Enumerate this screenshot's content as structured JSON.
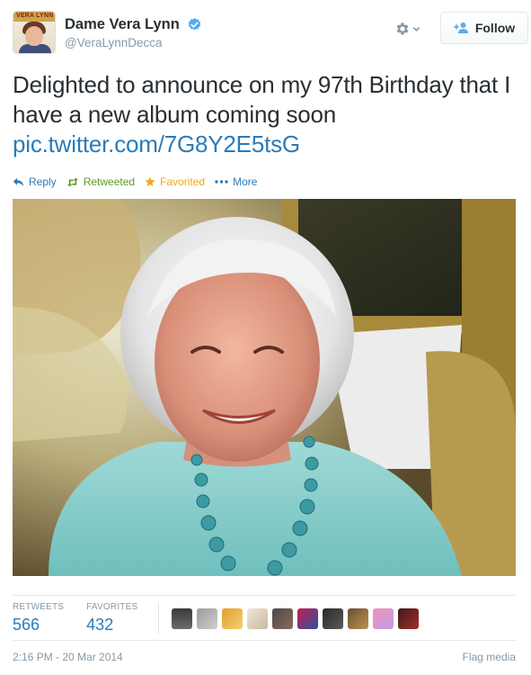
{
  "tweet": {
    "author": {
      "display_name": "Dame Vera Lynn",
      "handle": "@VeraLynnDecca",
      "avatar_text": "VERA LYNN",
      "verified": true
    },
    "follow_label": "Follow",
    "text": "Delighted to announce on my 97th Birthday that I have a new album coming soon",
    "link": "pic.twitter.com/7G8Y2E5tsG",
    "actions": {
      "reply": "Reply",
      "retweet": "Retweeted",
      "favorite": "Favorited",
      "more": "More"
    },
    "stats": {
      "retweets_label": "RETWEETS",
      "retweets": "566",
      "favorites_label": "FAVORITES",
      "favorites": "432"
    },
    "timestamp": "2:16 PM - 20 Mar 2014",
    "flag_media": "Flag media",
    "icons": [
      "verified-icon",
      "gear-icon",
      "chevron-down-icon",
      "add-user-icon",
      "reply-icon",
      "retweet-icon",
      "star-icon",
      "more-icon"
    ],
    "colors": {
      "link": "#2b7bb9",
      "retweeted": "#609928",
      "favorited": "#f1a720",
      "muted": "#8899a6"
    }
  }
}
